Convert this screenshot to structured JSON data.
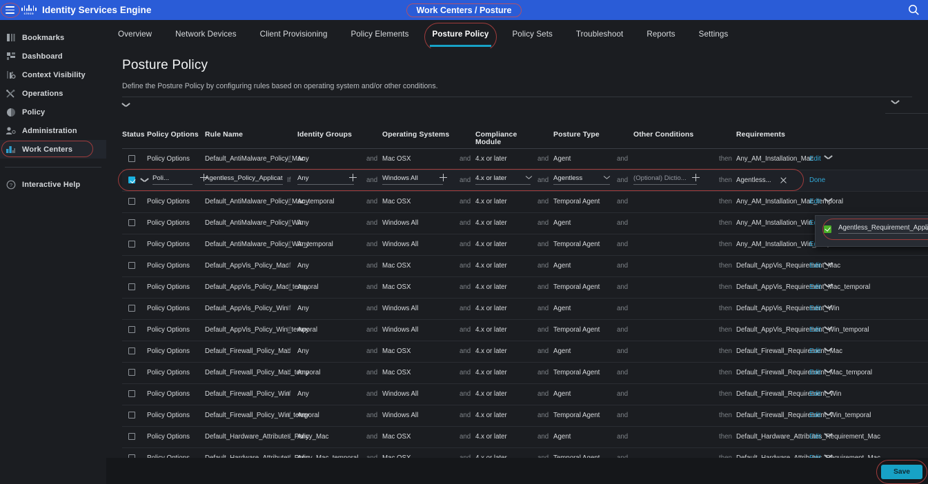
{
  "topbar": {
    "app_title": "Identity Services Engine",
    "breadcrumb": "Work Centers / Posture",
    "hamburger_icon": "hamburger-menu-icon",
    "logo_icon": "cisco-logo-icon",
    "search_icon": "search-icon",
    "brand_color": "#2a5cd7",
    "annotation_color": "#a03c3c"
  },
  "sidebar": {
    "items": [
      {
        "label": "Bookmarks",
        "icon": "bookmark-icon",
        "active": false
      },
      {
        "label": "Dashboard",
        "icon": "dashboard-icon",
        "active": false
      },
      {
        "label": "Context Visibility",
        "icon": "context-visibility-icon",
        "active": false
      },
      {
        "label": "Operations",
        "icon": "operations-tools-icon",
        "active": false
      },
      {
        "label": "Policy",
        "icon": "policy-icon",
        "active": false
      },
      {
        "label": "Administration",
        "icon": "administration-user-icon",
        "active": false
      },
      {
        "label": "Work Centers",
        "icon": "work-centers-chart-icon",
        "active": true
      }
    ],
    "help": {
      "label": "Interactive Help",
      "icon": "question-circle-icon"
    }
  },
  "tabs": [
    {
      "label": "Overview",
      "active": false
    },
    {
      "label": "Network Devices",
      "active": false
    },
    {
      "label": "Client Provisioning",
      "active": false
    },
    {
      "label": "Policy Elements",
      "active": false
    },
    {
      "label": "Posture Policy",
      "active": true
    },
    {
      "label": "Policy Sets",
      "active": false
    },
    {
      "label": "Troubleshoot",
      "active": false
    },
    {
      "label": "Reports",
      "active": false
    },
    {
      "label": "Settings",
      "active": false
    }
  ],
  "page": {
    "title": "Posture Policy",
    "subtitle": "Define the Posture Policy by configuring rules based on operating system and/or other conditions.",
    "collapse_icon_left": "chevron-down-icon",
    "collapse_icon_right": "chevron-down-icon"
  },
  "table": {
    "headers": [
      "Status",
      "Policy Options",
      "Rule Name",
      "Identity Groups",
      "Operating Systems",
      "Compliance Module",
      "Posture Type",
      "Other Conditions",
      "Requirements"
    ],
    "conj": {
      "if": "If",
      "and": "and",
      "then": "then"
    },
    "policy_options_label": "Policy Options",
    "edit_label": "Edit",
    "rows": [
      {
        "checked": false,
        "rule": "Default_AntiMalware_Policy_Mac",
        "idg": "Any",
        "os": "Mac OSX",
        "cm": "4.x or later",
        "pt": "Agent",
        "oc": "",
        "req": "Any_AM_Installation_Mac"
      },
      {
        "checked": false,
        "rule": "Default_AntiMalware_Policy_Mac_temporal",
        "idg": "Any",
        "os": "Mac OSX",
        "cm": "4.x or later",
        "pt": "Temporal Agent",
        "oc": "",
        "req": "Any_AM_Installation_Mac_temporal"
      },
      {
        "checked": false,
        "rule": "Default_AntiMalware_Policy_Win",
        "idg": "Any",
        "os": "Windows All",
        "cm": "4.x or later",
        "pt": "Agent",
        "oc": "",
        "req": "Any_AM_Installation_Win"
      },
      {
        "checked": false,
        "rule": "Default_AntiMalware_Policy_Win_temporal",
        "idg": "Any",
        "os": "Windows All",
        "cm": "4.x or later",
        "pt": "Temporal Agent",
        "oc": "",
        "req": "Any_AM_Installation_Win_temporal"
      },
      {
        "checked": false,
        "rule": "Default_AppVis_Policy_Mac",
        "idg": "Any",
        "os": "Mac OSX",
        "cm": "4.x or later",
        "pt": "Agent",
        "oc": "",
        "req": "Default_AppVis_Requirement_Mac"
      },
      {
        "checked": false,
        "rule": "Default_AppVis_Policy_Mac_temporal",
        "idg": "Any",
        "os": "Mac OSX",
        "cm": "4.x or later",
        "pt": "Temporal Agent",
        "oc": "",
        "req": "Default_AppVis_Requirement_Mac_temporal"
      },
      {
        "checked": false,
        "rule": "Default_AppVis_Policy_Win",
        "idg": "Any",
        "os": "Windows All",
        "cm": "4.x or later",
        "pt": "Agent",
        "oc": "",
        "req": "Default_AppVis_Requirement_Win"
      },
      {
        "checked": false,
        "rule": "Default_AppVis_Policy_Win_temporal",
        "idg": "Any",
        "os": "Windows All",
        "cm": "4.x or later",
        "pt": "Temporal Agent",
        "oc": "",
        "req": "Default_AppVis_Requirement_Win_temporal"
      },
      {
        "checked": false,
        "rule": "Default_Firewall_Policy_Mac",
        "idg": "Any",
        "os": "Mac OSX",
        "cm": "4.x or later",
        "pt": "Agent",
        "oc": "",
        "req": "Default_Firewall_Requirement_Mac"
      },
      {
        "checked": false,
        "rule": "Default_Firewall_Policy_Mac_temporal",
        "idg": "Any",
        "os": "Mac OSX",
        "cm": "4.x or later",
        "pt": "Temporal Agent",
        "oc": "",
        "req": "Default_Firewall_Requirement_Mac_temporal"
      },
      {
        "checked": false,
        "rule": "Default_Firewall_Policy_Win",
        "idg": "Any",
        "os": "Windows All",
        "cm": "4.x or later",
        "pt": "Agent",
        "oc": "",
        "req": "Default_Firewall_Requirement_Win"
      },
      {
        "checked": false,
        "rule": "Default_Firewall_Policy_Win_temporal",
        "idg": "Any",
        "os": "Windows All",
        "cm": "4.x or later",
        "pt": "Temporal Agent",
        "oc": "",
        "req": "Default_Firewall_Requirement_Win_temporal"
      },
      {
        "checked": false,
        "rule": "Default_Hardware_Attributes_Policy_Mac",
        "idg": "Any",
        "os": "Mac OSX",
        "cm": "4.x or later",
        "pt": "Agent",
        "oc": "",
        "req": "Default_Hardware_Attributes_Requirement_Mac"
      },
      {
        "checked": false,
        "rule": "Default_Hardware_Attributes_Policy_Mac_temporal",
        "idg": "Any",
        "os": "Mac OSX",
        "cm": "4.x or later",
        "pt": "Temporal Agent",
        "oc": "",
        "req": "Default_Hardware_Attributes_Requirement_Mac"
      }
    ],
    "editing_row": {
      "checked": true,
      "policy_options_value": "Poli...",
      "rule_value": "Agentless_Policy_Applicatio",
      "idg_value": "Any",
      "os_value": "Windows All",
      "cm_value": "4.x or later",
      "pt_value": "Agentless",
      "oc_value": "(Optional) Dictio...",
      "req_value": "Agentless...",
      "done_label": "Done",
      "row_chevron_icon": "chevron-down-icon",
      "remove_icon": "close-x-icon",
      "add_icon": "plus-icon"
    }
  },
  "requirement_dropdown": {
    "selected": "Agentless_Requirement_Appli",
    "checkbox_icon": "green-check-checkbox-icon",
    "checkbox_color": "#4caf28",
    "delete_icon": "trash-icon",
    "add_icon": "plus-icon",
    "chevron_icon": "chevron-down-icon"
  },
  "footer": {
    "save_label": "Save",
    "save_color": "#17a2c6"
  }
}
